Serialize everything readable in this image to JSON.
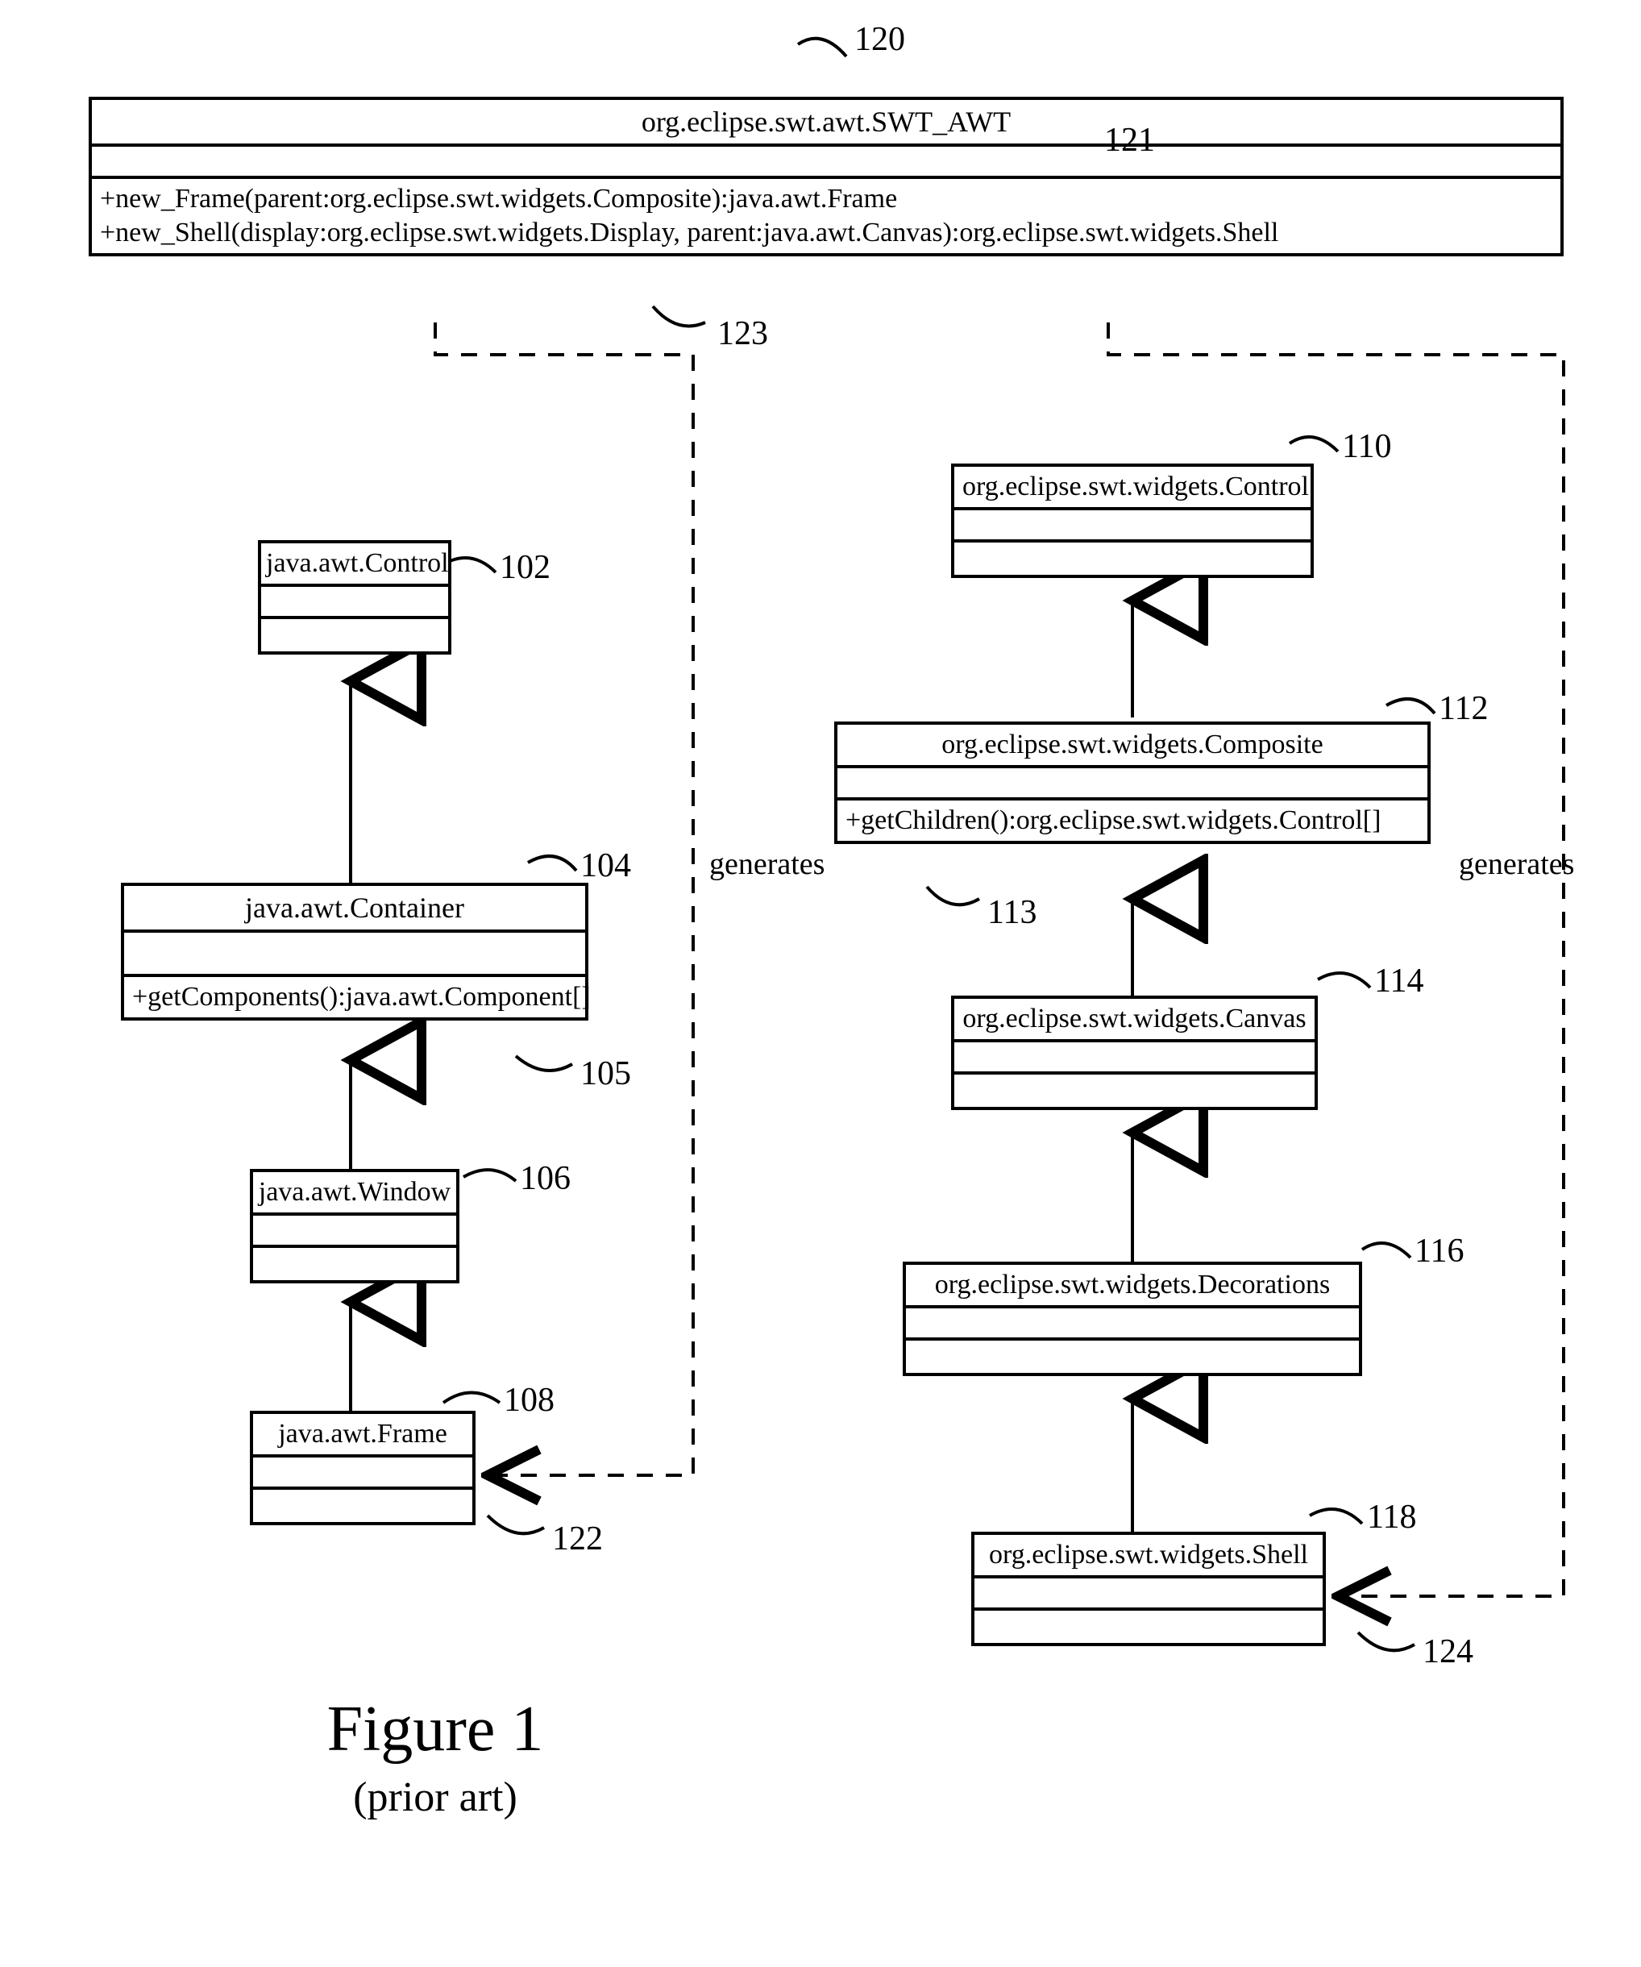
{
  "figure": {
    "title": "Figure 1",
    "subtitle": "(prior art)"
  },
  "boxes": {
    "swtawt": {
      "title": "org.eclipse.swt.awt.SWT_AWT",
      "op1": "+new_Frame(parent:org.eclipse.swt.widgets.Composite):java.awt.Frame",
      "op2": "+new_Shell(display:org.eclipse.swt.widgets.Display, parent:java.awt.Canvas):org.eclipse.swt.widgets.Shell"
    },
    "awtControl": {
      "title": "java.awt.Control"
    },
    "awtContainer": {
      "title": "java.awt.Container",
      "op1": "+getComponents():java.awt.Component[]"
    },
    "awtWindow": {
      "title": "java.awt.Window"
    },
    "awtFrame": {
      "title": "java.awt.Frame"
    },
    "swtControl": {
      "title": "org.eclipse.swt.widgets.Control"
    },
    "swtComposite": {
      "title": "org.eclipse.swt.widgets.Composite",
      "op1": "+getChildren():org.eclipse.swt.widgets.Control[]"
    },
    "swtCanvas": {
      "title": "org.eclipse.swt.widgets.Canvas"
    },
    "swtDecorations": {
      "title": "org.eclipse.swt.widgets.Decorations"
    },
    "swtShell": {
      "title": "org.eclipse.swt.widgets.Shell"
    }
  },
  "labels": {
    "l120": "120",
    "l121": "121",
    "l123": "123",
    "l102": "102",
    "l104": "104",
    "l105": "105",
    "l106": "106",
    "l108": "108",
    "l110": "110",
    "l112": "112",
    "l113": "113",
    "l114": "114",
    "l116": "116",
    "l118": "118",
    "l122": "122",
    "l124": "124",
    "generates1": "generates",
    "generates2": "generates"
  }
}
